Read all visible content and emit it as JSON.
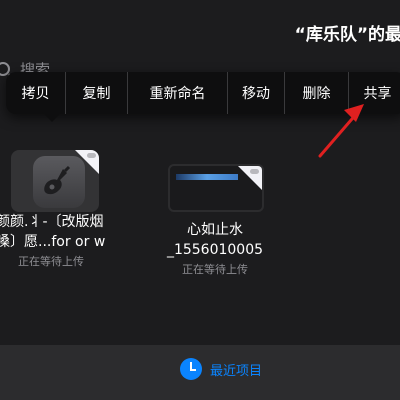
{
  "header": {
    "title": "“库乐队”的最"
  },
  "search": {
    "placeholder": "搜索"
  },
  "context_menu": {
    "items": [
      {
        "label": "拷贝"
      },
      {
        "label": "复制"
      },
      {
        "label": "重新命名"
      },
      {
        "label": "移动"
      },
      {
        "label": "删除"
      },
      {
        "label": "共享"
      }
    ]
  },
  "annotation": {
    "arrow_color": "#e02020"
  },
  "files": [
    {
      "name_line1": "颜颜.丬-〔改版烟",
      "name_line2": "嗓〕愿...for or w",
      "status": "正在等待上传",
      "icon": "garageband-icon"
    },
    {
      "name_line1": "心如止水",
      "name_line2": "_1556010005",
      "status": "正在等待上传",
      "icon": "document-thumbnail"
    }
  ],
  "tabbar": {
    "recent_label": "最近项目",
    "accent": "#0a84ff"
  }
}
